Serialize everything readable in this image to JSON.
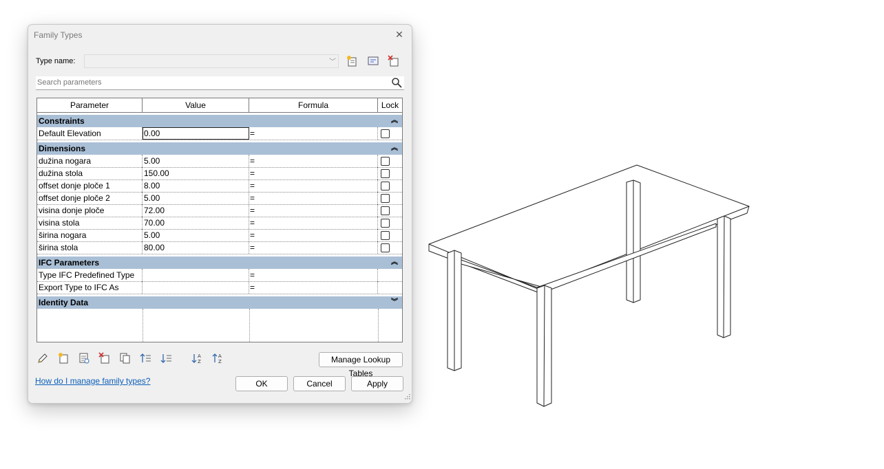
{
  "dialog": {
    "title": "Family Types",
    "type_name_label": "Type name:",
    "type_name_value": "",
    "search_placeholder": "Search parameters",
    "columns": {
      "parameter": "Parameter",
      "value": "Value",
      "formula": "Formula",
      "lock": "Lock"
    },
    "groups": {
      "constraints": {
        "label": "Constraints",
        "rows": [
          {
            "parameter": "Default Elevation",
            "value": "0.00",
            "formula": "="
          }
        ]
      },
      "dimensions": {
        "label": "Dimensions",
        "rows": [
          {
            "parameter": "dužina nogara",
            "value": "5.00",
            "formula": "="
          },
          {
            "parameter": "dužina stola",
            "value": "150.00",
            "formula": "="
          },
          {
            "parameter": "offset donje ploče 1",
            "value": "8.00",
            "formula": "="
          },
          {
            "parameter": "offset donje ploče 2",
            "value": "5.00",
            "formula": "="
          },
          {
            "parameter": "visina donje ploče",
            "value": "72.00",
            "formula": "="
          },
          {
            "parameter": "visina stola",
            "value": "70.00",
            "formula": "="
          },
          {
            "parameter": "širina nogara",
            "value": "5.00",
            "formula": "="
          },
          {
            "parameter": "širina stola",
            "value": "80.00",
            "formula": "="
          }
        ]
      },
      "ifc": {
        "label": "IFC Parameters",
        "rows": [
          {
            "parameter": "Type IFC Predefined Type",
            "value": "",
            "formula": "="
          },
          {
            "parameter": "Export Type to IFC As",
            "value": "",
            "formula": "="
          }
        ]
      },
      "identity": {
        "label": "Identity Data"
      }
    },
    "manage_lookup_label": "Manage Lookup Tables",
    "help_link": "How do I manage family types?",
    "ok_label": "OK",
    "cancel_label": "Cancel",
    "apply_label": "Apply"
  }
}
